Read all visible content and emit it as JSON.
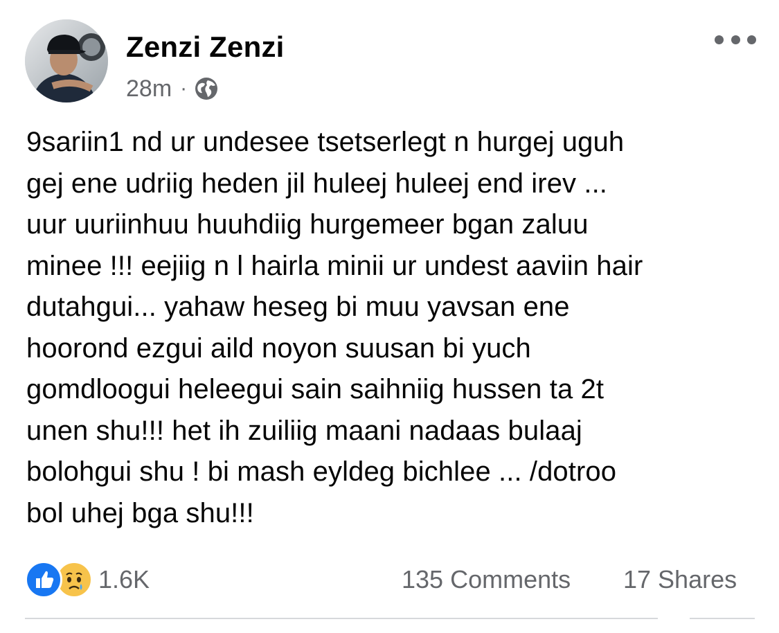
{
  "post": {
    "author": {
      "name": "Zenzi Zenzi",
      "avatar_icon": "profile-photo"
    },
    "meta": {
      "time": "28m",
      "separator": "·",
      "privacy_icon": "globe-icon"
    },
    "more_icon": "more-horizontal-icon",
    "text": "9sariin1 nd ur undesee tsetserlegt n hurgej uguh\ngej  ene udriig heden jil huleej huleej end irev ...\nuur uuriinhuu huuhdiig hurgemeer bgan zaluu\nminee !!! eejiig n l hairla minii ur undest aaviin hair\ndutahgui...  yahaw heseg bi  muu yavsan ene\nhoorond ezgui aild noyon suusan bi yuch\ngomdloogui heleegui sain saihniig hussen ta 2t\nunen shu!!! het ih zuiliig maani nadaas bulaaj\nbolohgui shu ! bi mash eyldeg bichlee ... /dotroo\nbol uhej bga shu!!!",
    "reactions": {
      "icons": [
        "like-icon",
        "sad-icon"
      ],
      "count": "1.6K"
    },
    "comments": "135 Comments",
    "shares": "17 Shares"
  },
  "colors": {
    "text": "#050505",
    "secondary": "#65676b",
    "like_blue": "#1877f2",
    "sad_yellow": "#f7c34b",
    "divider": "#d6d8db"
  }
}
